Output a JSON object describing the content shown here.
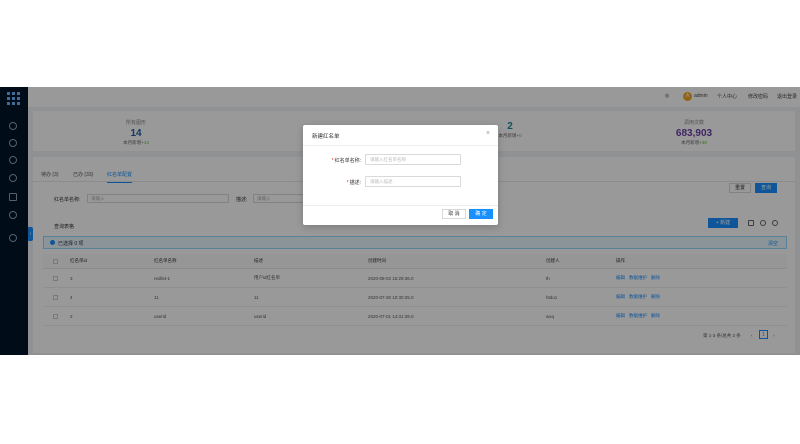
{
  "header": {
    "user": "admin",
    "avatar_letter": "A",
    "personal_center": "个人中心",
    "change_password": "修改密码",
    "logout": "退出登录"
  },
  "stats": [
    {
      "label": "所有图形",
      "value": "14",
      "sub_prefix": "本月新增+",
      "sub_value": "14",
      "color": "#1f5fa8"
    },
    {
      "label": "",
      "value": "",
      "sub_prefix": "",
      "sub_value": "",
      "color": "#1f5fa8"
    },
    {
      "label": "",
      "value": "2",
      "sub_prefix": "本月新增+",
      "sub_value": "0",
      "color": "#1a8a9a"
    },
    {
      "label": "调用次数",
      "value": "683,903",
      "sub_prefix": "本月新增+",
      "sub_value": "30",
      "color": "#6a3da8"
    }
  ],
  "tabs": [
    "待办 (3)",
    "已办 (33)",
    "红名单配置"
  ],
  "filters": {
    "name_label": "红名单名称:",
    "name_placeholder": "请输入",
    "desc_label": "描述:",
    "desc_placeholder": "请输入"
  },
  "buttons": {
    "reset": "重置",
    "query": "查询",
    "new": "+ 新建"
  },
  "section_title": "查询表格",
  "alert": {
    "text": "已选择 0 项",
    "clear": "清空"
  },
  "table": {
    "columns": [
      "红名单id",
      "红名单名称",
      "描述",
      "创建时间",
      "创建人",
      "操作"
    ],
    "rows": [
      {
        "id": "3",
        "name": "redlist-1",
        "desc": "用户id红名单",
        "time": "2020-08-02 15:29:36.0",
        "creator": "th"
      },
      {
        "id": "4",
        "name": "11",
        "desc": "11",
        "time": "2020-07-30 10:30:25.0",
        "creator": "htdo1"
      },
      {
        "id": "2",
        "name": "userid",
        "desc": "userid",
        "time": "2020-07-01 14:31:39.0",
        "creator": "wxq"
      }
    ],
    "ops": [
      "编辑",
      "数据维护",
      "删除"
    ]
  },
  "pagination": {
    "summary": "第 1-3 条/总共 3 条",
    "current": "1"
  },
  "modal": {
    "title": "新建红名单",
    "close": "×",
    "name_label": "红名单名称:",
    "name_placeholder": "请输入红名单名称",
    "desc_label": "描述:",
    "desc_placeholder": "请输入描述",
    "cancel": "取 消",
    "confirm": "确 定"
  },
  "colors": {
    "accent": "#1890ff",
    "sidebar": "#001529",
    "required": "#f5222d"
  }
}
